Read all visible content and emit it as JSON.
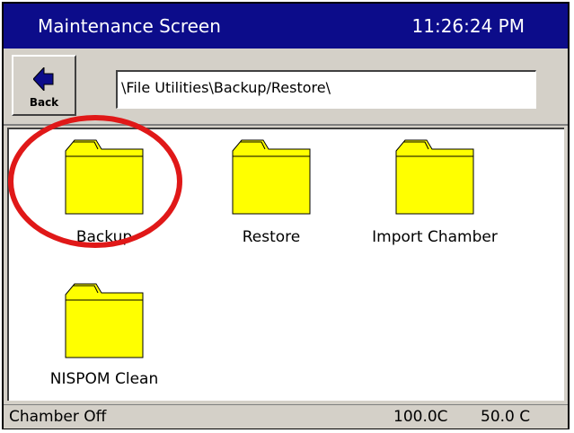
{
  "window": {
    "title": "Maintenance Screen",
    "clock": "11:26:24 PM"
  },
  "toolbar": {
    "back_label": "Back",
    "path": "\\File Utilities\\Backup/Restore\\"
  },
  "folders": [
    {
      "label": "Backup"
    },
    {
      "label": "Restore"
    },
    {
      "label": "Import Chamber"
    },
    {
      "label": "NISPOM Clean"
    }
  ],
  "status": {
    "chamber_state": "Chamber Off",
    "temp_1": "100.0C",
    "temp_2": "50.0 C"
  },
  "colors": {
    "title_bg": "#0c0c8a",
    "folder_fill": "#ffff00",
    "highlight": "#e01818",
    "chrome": "#d4d0c8"
  },
  "icons": [
    "back-arrow-icon",
    "folder-icon"
  ]
}
